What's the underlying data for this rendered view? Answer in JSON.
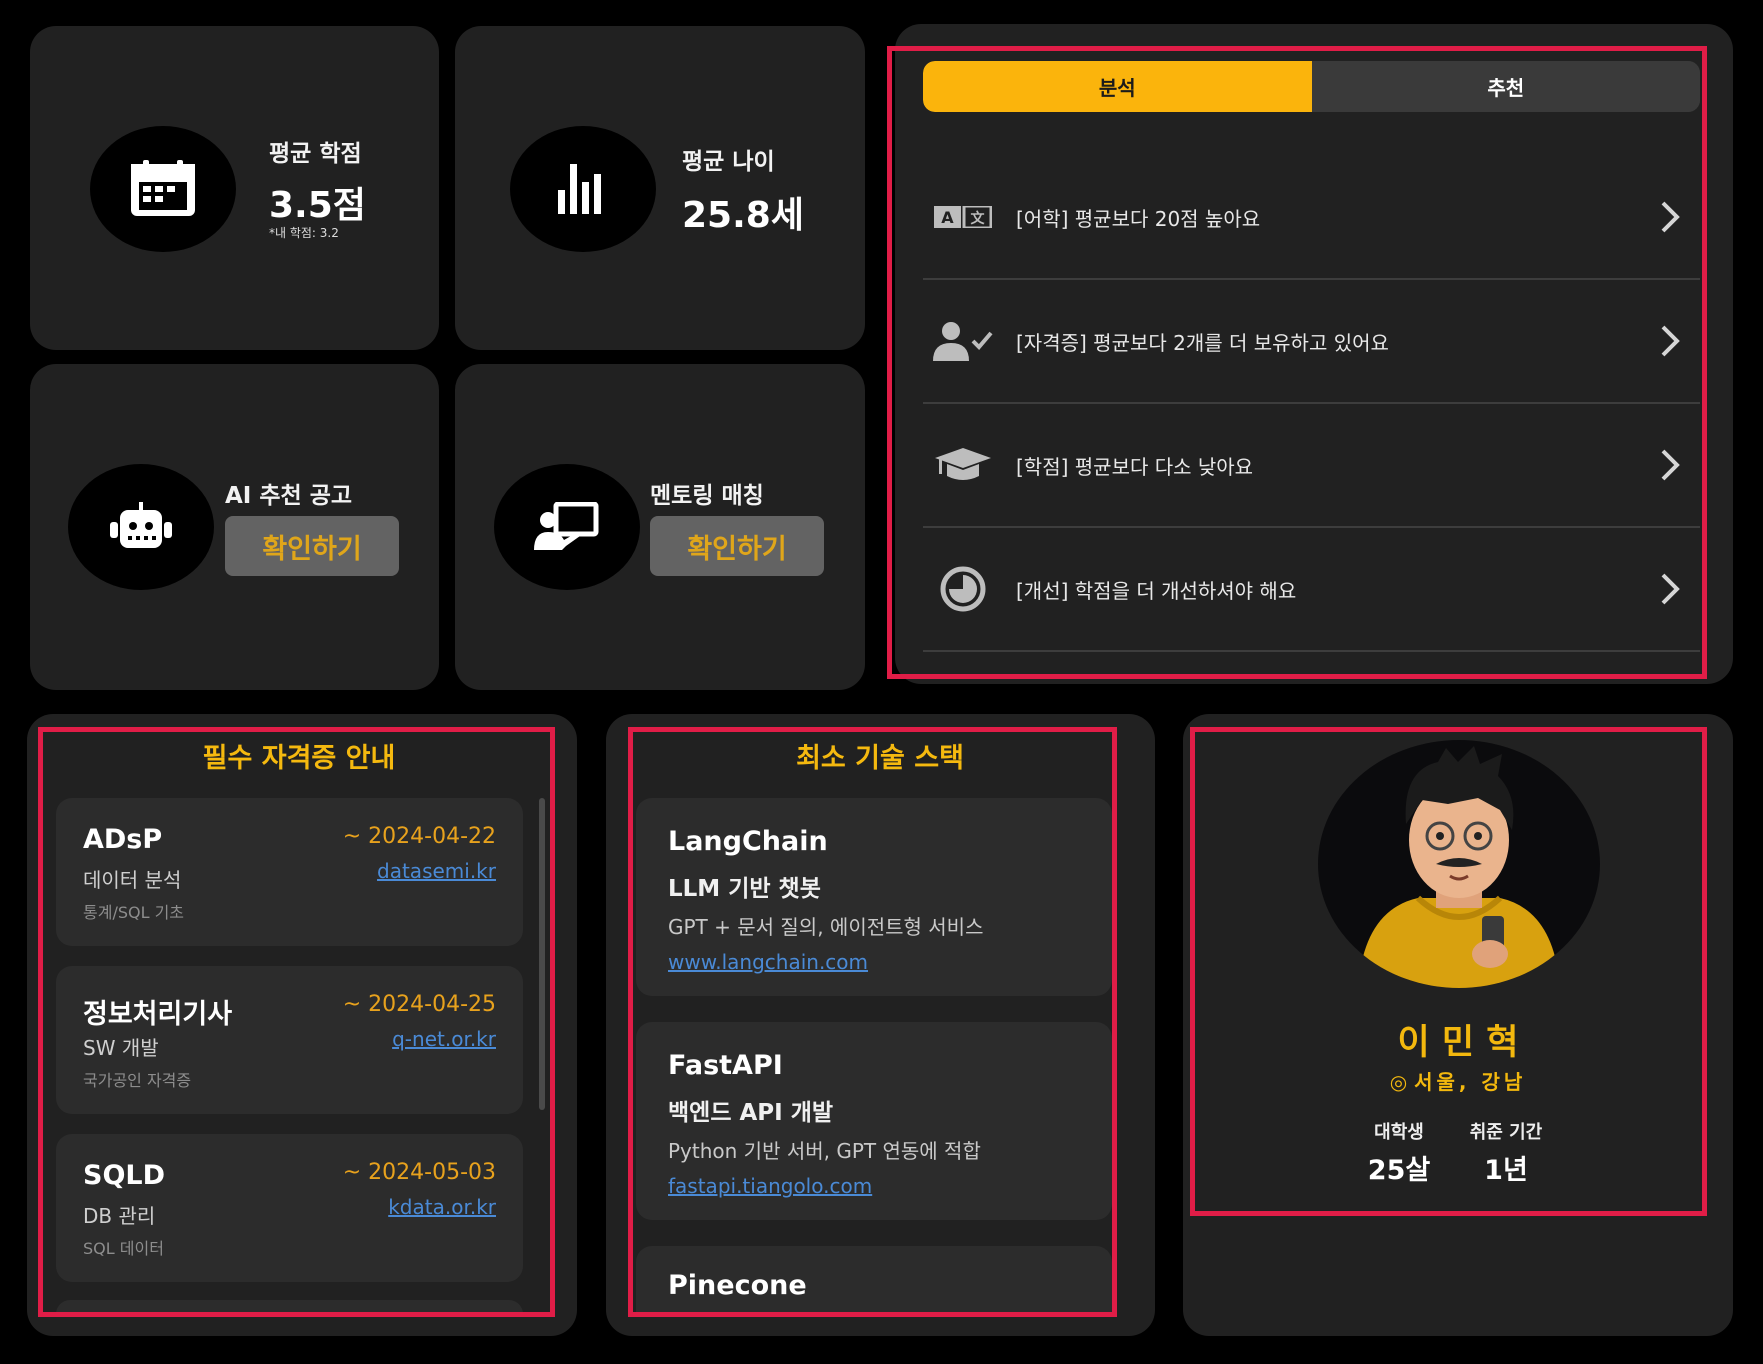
{
  "stats": {
    "gpa": {
      "title": "평균 학점",
      "value": "3.5점",
      "sub": "*내 학점: 3.2"
    },
    "age": {
      "title": "평균 나이",
      "value": "25.8세"
    },
    "ai_jobs": {
      "title": "AI 추천 공고",
      "button": "확인하기"
    },
    "mentoring": {
      "title": "멘토링 매칭",
      "button": "확인하기"
    }
  },
  "analysis": {
    "tabs": [
      {
        "label": "분석",
        "active": true
      },
      {
        "label": "추천",
        "active": false
      }
    ],
    "items": [
      {
        "icon": "language-icon",
        "text": "[어학] 평균보다 20점 높아요"
      },
      {
        "icon": "user-check-icon",
        "text": "[자격증] 평균보다 2개를 더 보유하고 있어요"
      },
      {
        "icon": "graduation-cap-icon",
        "text": "[학점] 평균보다 다소 낮아요"
      },
      {
        "icon": "pie-chart-icon",
        "text": "[개선] 학점을 더 개선하셔야 해요"
      }
    ]
  },
  "certificates": {
    "title": "필수 자격증 안내",
    "items": [
      {
        "name": "ADsP",
        "field": "데이터 분석",
        "desc": "통계/SQL 기초",
        "date": "~ 2024-04-22",
        "link": "datasemi.kr"
      },
      {
        "name": "정보처리기사",
        "field": "SW 개발",
        "desc": "국가공인 자격증",
        "date": "~ 2024-04-25",
        "link": "q-net.or.kr"
      },
      {
        "name": "SQLD",
        "field": "DB 관리",
        "desc": "SQL 데이터",
        "date": "~ 2024-05-03",
        "link": "kdata.or.kr"
      }
    ]
  },
  "tech_stack": {
    "title": "최소 기술 스택",
    "items": [
      {
        "name": "LangChain",
        "subtitle": "LLM 기반 챗봇",
        "desc": "GPT + 문서 질의, 에이전트형 서비스",
        "link": "www.langchain.com"
      },
      {
        "name": "FastAPI",
        "subtitle": "백엔드 API 개발",
        "desc": "Python 기반 서버, GPT 연동에 적합",
        "link": "fastapi.tiangolo.com"
      },
      {
        "name": "Pinecone"
      }
    ]
  },
  "profile": {
    "name": "이 민 혁",
    "location": "서울, 강남",
    "stats": [
      {
        "label": "대학생",
        "value": "25살"
      },
      {
        "label": "취준 기간",
        "value": "1년"
      }
    ]
  },
  "colors": {
    "accent": "#fbb40c",
    "highlight_border": "#e01d47",
    "card": "#212121",
    "link": "#4a8ad6"
  }
}
